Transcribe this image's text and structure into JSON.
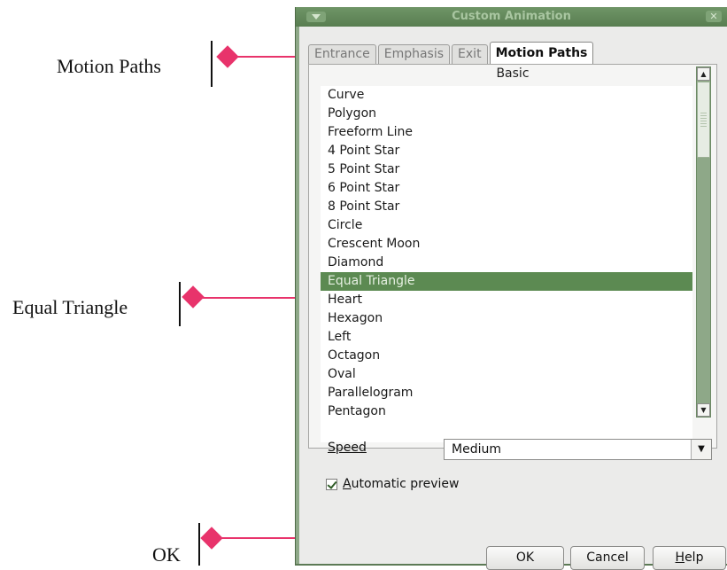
{
  "annotations": {
    "motion_paths": "Motion Paths",
    "equal_triangle": "Equal Triangle",
    "ok": "OK"
  },
  "dialog": {
    "title": "Custom Animation",
    "tabs": [
      "Entrance",
      "Emphasis",
      "Exit",
      "Motion Paths"
    ],
    "active_tab": "Motion Paths",
    "section_header": "Basic",
    "items": [
      "Curve",
      "Polygon",
      "Freeform Line",
      "4 Point Star",
      "5 Point Star",
      "6 Point Star",
      "8 Point Star",
      "Circle",
      "Crescent Moon",
      "Diamond",
      "Equal Triangle",
      "Heart",
      "Hexagon",
      "Left",
      "Octagon",
      "Oval",
      "Parallelogram",
      "Pentagon"
    ],
    "selected_item": "Equal Triangle",
    "speed_label": "Speed",
    "speed_value": "Medium",
    "auto_preview_label": "Automatic preview",
    "auto_preview_checked": true,
    "buttons": {
      "ok": "OK",
      "cancel": "Cancel",
      "help": "Help"
    }
  },
  "colors": {
    "callout": "#e8336b",
    "window_frame": "#8ea888",
    "selection": "#5c8a52"
  }
}
